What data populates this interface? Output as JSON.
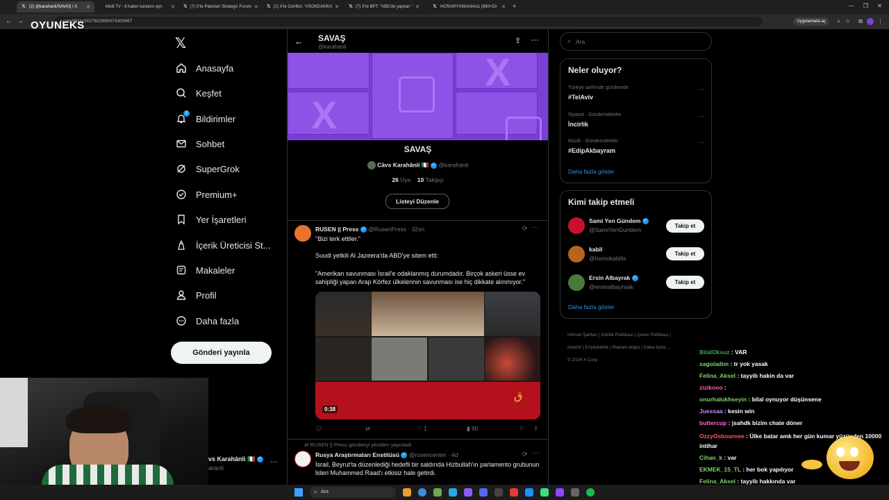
{
  "browser": {
    "tabs": [
      {
        "title": "(2) @karahanli/SAVAŞ / X",
        "active": true
      },
      {
        "title": "Multi TV - 6 haber kanalını ayn"
      },
      {
        "title": "(7) X'te Pakistan Strategic Forum"
      },
      {
        "title": "(1) X'te Conflict: \"#SONDAKİKA"
      },
      {
        "title": "(7) X'te BPT: \"ABD'de yapılan \""
      },
      {
        "title": "HCRmRYXMAA9Ao1 (680×53"
      }
    ],
    "url": "x.com/i/lists/2027822690074300467",
    "open_in_app": "Uygulamada aç"
  },
  "overlay": {
    "brand": "OYUNEKS"
  },
  "sidebar": {
    "items": [
      {
        "label": "Anasayfa",
        "icon": "home-icon"
      },
      {
        "label": "Keşfet",
        "icon": "search-icon"
      },
      {
        "label": "Bildirimler",
        "icon": "bell-icon",
        "badge": "2"
      },
      {
        "label": "Sohbet",
        "icon": "mail-icon"
      },
      {
        "label": "SuperGrok",
        "icon": "grok-icon"
      },
      {
        "label": "Premium+",
        "icon": "premium-icon"
      },
      {
        "label": "Yer İşaretleri",
        "icon": "bookmark-icon"
      },
      {
        "label": "İçerik Üreticisi St...",
        "icon": "studio-icon"
      },
      {
        "label": "Makaleler",
        "icon": "article-icon"
      },
      {
        "label": "Profil",
        "icon": "person-icon"
      },
      {
        "label": "Daha fazla",
        "icon": "more-icon"
      }
    ],
    "post_button": "Gönderi yayınla",
    "account": {
      "name": "vs Karahânli 🇮🇹",
      "handle": "aranli"
    }
  },
  "main": {
    "header_title": "SAVAŞ",
    "header_handle": "@karahanli",
    "list_name": "SAVAŞ",
    "owner_name": "Cāvs Karahânli 🇮🇹",
    "owner_handle": "@karahanli",
    "members_count": "26",
    "members_label": "Üye",
    "followers_count": "10",
    "followers_label": "Takipçi",
    "edit_button": "Listeyi Düzenle",
    "tweet1": {
      "author": "RUSEN || Press",
      "handle": "@RusenPress",
      "time": "· 32sn",
      "line1": "\"Bizi terk ettiler.\"",
      "line2": "Suudi yetkili Al Jazeera'da ABD'ye sitem etti:",
      "line3": "\"Amerikan savunması İsrail'e odaklanmış durumdadır. Birçok askeri üsse ev sahipliği yapan Arap Körfez ülkelerinin savunması ise hiç dikkate alınmıyor.\"",
      "video_duration": "0:38",
      "likes": "1",
      "views": "90"
    },
    "repost_label": "RUSEN || Press gönderiyi yeniden yayınladı",
    "tweet2": {
      "author": "Rusya Araştırmaları Enstitüsü",
      "handle": "@rusencenter",
      "time": "· 4d",
      "text": "İsrail, Beyrut'ta düzenlediği hedefli bir saldırıda Hizbullah'ın parlamento grubunun lideri Muhammed Raad'ı etkisiz hale getirdi."
    }
  },
  "right": {
    "search_placeholder": "Ara",
    "trends_title": "Neler oluyor?",
    "trends": [
      {
        "meta": "Türkiye tarihinde gündemde",
        "name": "#TelAviv"
      },
      {
        "meta": "Siyaset · Gündemdekiler",
        "name": "İncirlik"
      },
      {
        "meta": "Müzik · Gündemdekiler",
        "name": "#EdipAkbayram"
      }
    ],
    "show_more": "Daha fazla göster",
    "who_title": "Kimi takip etmeli",
    "who": [
      {
        "name": "Sami Yen Gündem",
        "handle": "@SamiYenGundem",
        "verified": true,
        "color": "#c8102e"
      },
      {
        "name": "kabil",
        "handle": "@homokabilis",
        "verified": false,
        "color": "#b5651d"
      },
      {
        "name": "Ersin Albayrak",
        "handle": "@ersinalbayraak",
        "verified": true,
        "color": "#4a7a3a"
      }
    ],
    "follow_label": "Takip et",
    "footer": [
      "Hizmet Şartları",
      "Gizlilik Politikası",
      "Çerez Politikası",
      "Imprint",
      "Erişilebilirlik",
      "Reklam bilgisi",
      "Daha fazla ...",
      "© 2026 X Corp."
    ]
  },
  "chat": [
    {
      "user": "BilalOksuz",
      "msg": "VAR",
      "color": "#3fa34d"
    },
    {
      "user": "sagoladim",
      "msg": "tr yok yasak",
      "color": "#7fd36b"
    },
    {
      "user": "Felina_Aksel",
      "msg": "tayyib hakin da var",
      "color": "#7fd36b"
    },
    {
      "user": "zizikooo",
      "msg": "",
      "color": "#ff5fa2"
    },
    {
      "user": "onurhalukhseyin",
      "msg": "bilal oynuyor düşünsene",
      "color": "#7fd36b"
    },
    {
      "user": "Juessaa",
      "msg": "kesin win",
      "color": "#c98cff"
    },
    {
      "user": "buttercup",
      "msg": "jsahdk bizim chate döner",
      "color": "#ff6ad5"
    },
    {
      "user": "OzzyOsbournee",
      "msg": "Ülke batar amk her gün kumar yüzünden 10000 intihar",
      "color": "#ff5959"
    },
    {
      "user": "Cihan_k",
      "msg": "var",
      "color": "#7fd36b"
    },
    {
      "user": "EKMEK_15_TL",
      "msg": "her bok yapılıyor",
      "color": "#7fd36b"
    },
    {
      "user": "Felina_Aksel",
      "msg": "tayyib hakkında var",
      "color": "#7fd36b"
    }
  ],
  "taskbar": {
    "search_placeholder": "Ara"
  }
}
